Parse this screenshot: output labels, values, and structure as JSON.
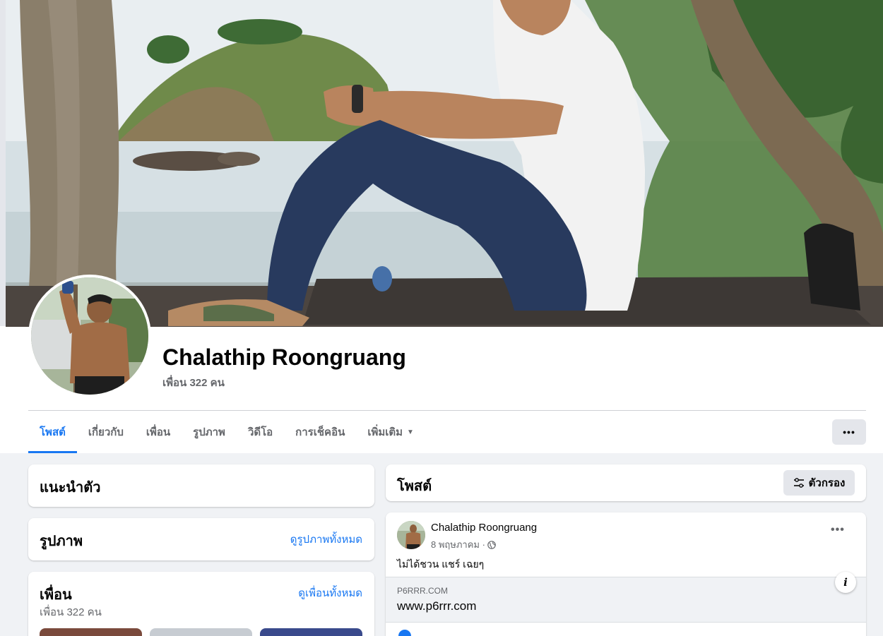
{
  "profile": {
    "name": "Chalathip Roongruang",
    "friend_count": "เพื่อน 322 คน"
  },
  "tabs": [
    {
      "label": "โพสต์",
      "active": true
    },
    {
      "label": "เกี่ยวกับ",
      "active": false
    },
    {
      "label": "เพื่อน",
      "active": false
    },
    {
      "label": "รูปภาพ",
      "active": false
    },
    {
      "label": "วิดีโอ",
      "active": false
    },
    {
      "label": "การเช็คอิน",
      "active": false
    },
    {
      "label": "เพิ่มเติม",
      "active": false
    }
  ],
  "more_button": "•••",
  "intro_card": {
    "title": "แนะนำตัว"
  },
  "photos_card": {
    "title": "รูปภาพ",
    "link": "ดูรูปภาพทั้งหมด"
  },
  "friends_card": {
    "title": "เพื่อน",
    "link": "ดูเพื่อนทั้งหมด",
    "count": "เพื่อน 322 คน"
  },
  "posts_header": {
    "title": "โพสต์",
    "filter_label": "ตัวกรอง"
  },
  "post": {
    "author": "Chalathip Roongruang",
    "date": "8 พฤษภาคม ·",
    "text": "ไม่ได้ชวน แชร์ เฉยๆ",
    "more": "•••",
    "link_domain": "P6RRR.COM",
    "link_title": "www.p6rrr.com",
    "info_icon": "i"
  },
  "colors": {
    "accent": "#1877f2",
    "background": "#f0f2f5",
    "secondary_text": "#65676b"
  }
}
